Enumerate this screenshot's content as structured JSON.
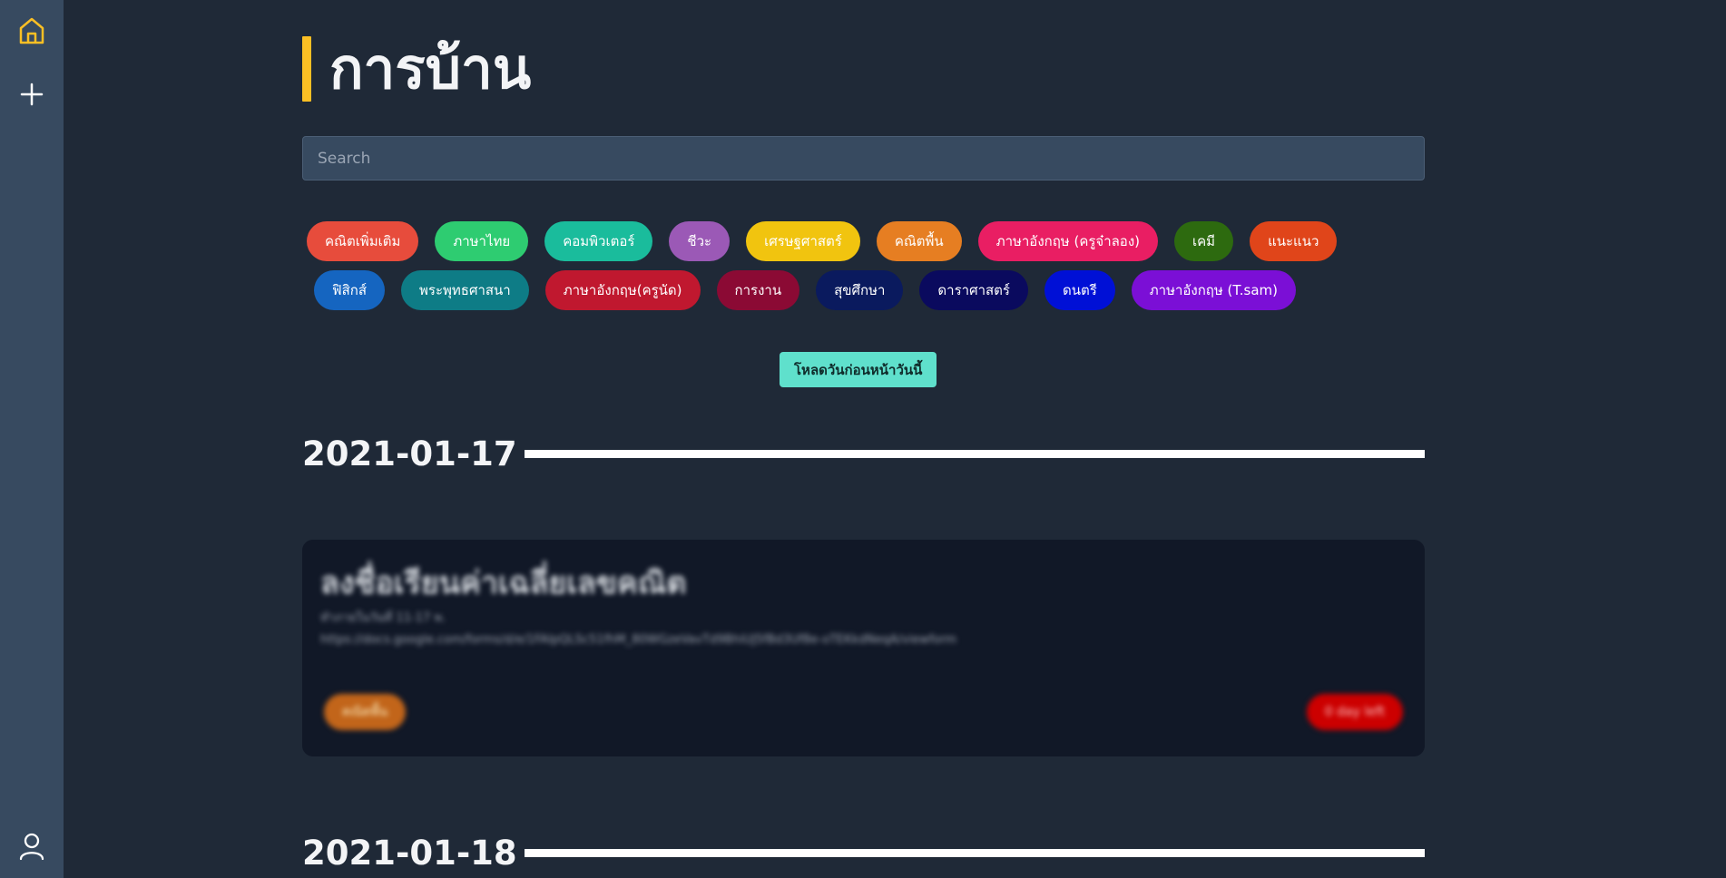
{
  "sidebar": {
    "home_icon_color": "#fbbf24",
    "icons": [
      "home-icon",
      "plus-icon",
      "user-icon"
    ]
  },
  "header": {
    "title": "การบ้าน",
    "accent": "#fbbf24"
  },
  "search": {
    "placeholder": "Search",
    "value": ""
  },
  "subjects": {
    "row1": [
      {
        "label": "คณิตเพิ่มเติม",
        "color": "#e74c3c"
      },
      {
        "label": "ภาษาไทย",
        "color": "#2ecc71"
      },
      {
        "label": "คอมพิวเตอร์",
        "color": "#1abc9c"
      },
      {
        "label": "ชีวะ",
        "color": "#9b59b6"
      },
      {
        "label": "เศรษฐศาสตร์",
        "color": "#f1c40f"
      },
      {
        "label": "คณิตพื้น",
        "color": "#e67e22"
      },
      {
        "label": "ภาษาอังกฤษ (ครูจ๋าลอง)",
        "color": "#e91e63"
      },
      {
        "label": "เคมี",
        "color": "#2d6a0f"
      },
      {
        "label": "แนะแนว",
        "color": "#e0451a"
      }
    ],
    "row2": [
      {
        "label": "ฟิสิกส์",
        "color": "#1565c0"
      },
      {
        "label": "พระพุทธศาสนา",
        "color": "#0e7c86"
      },
      {
        "label": "ภาษาอังกฤษ(ครูนัด)",
        "color": "#c0182f"
      },
      {
        "label": "การงาน",
        "color": "#8b0a34"
      },
      {
        "label": "สุขศึกษา",
        "color": "#0a1a5e"
      },
      {
        "label": "ดาราศาสตร์",
        "color": "#0a0a5e"
      },
      {
        "label": "ดนตรี",
        "color": "#0010d6"
      },
      {
        "label": "ภาษาอังกฤษ (T.sam)",
        "color": "#7b0fd6"
      }
    ]
  },
  "load_button": {
    "label": "โหลดวันก่อนหน้าวันนี้",
    "color": "#5fe0cc"
  },
  "days": [
    {
      "date": "2021-01-17",
      "card": {
        "title": "ลงชื่อเรียนค่าเฉลี่ยเลขคณิต",
        "desc_line1": "ทำภายในวันที่ 11-17 พ.",
        "desc_line2": "https://docs.google.com/forms/d/e/1FAIpQLSc51fhM_80WGzeVavTd9BhiUJ5fBd3Uf8e-oTEKkdNeqA/viewform",
        "tag": "คณิตพื้น",
        "tag_color": "#c2651a",
        "due": "0 day left",
        "due_color": "#cc0000"
      }
    },
    {
      "date": "2021-01-18"
    }
  ]
}
